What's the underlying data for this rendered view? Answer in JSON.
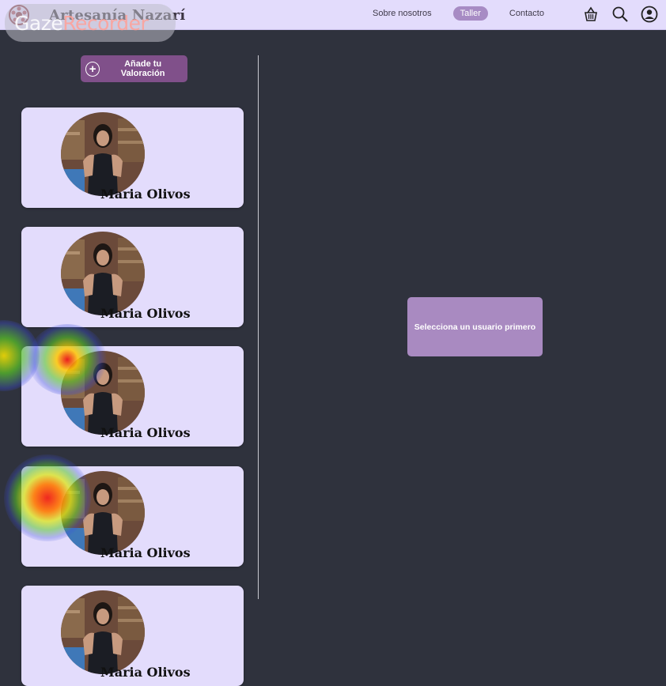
{
  "brand": {
    "name": "Artesanía Nazarí",
    "logo_icon": "pottery-logo-icon"
  },
  "nav": {
    "items": [
      {
        "label": "Sobre nosotros",
        "active": false
      },
      {
        "label": "Taller",
        "active": true
      },
      {
        "label": "Contacto",
        "active": false
      }
    ]
  },
  "header_icons": [
    "basket-icon",
    "search-icon",
    "user-account-icon"
  ],
  "watermark": {
    "part1": "Gaze",
    "part2": "Recorder"
  },
  "reviews": {
    "add_label": "Añade tu Valoración",
    "users": [
      {
        "name": "Maria Olivos"
      },
      {
        "name": "Maria Olivos"
      },
      {
        "name": "Maria Olivos"
      },
      {
        "name": "Maria Olivos"
      },
      {
        "name": "Maria Olivos"
      }
    ]
  },
  "detail": {
    "empty_message": "Selecciona un usuario primero"
  },
  "colors": {
    "topbar": "#e3dcfc",
    "background": "#2f323d",
    "card": "#e3dcfc",
    "accent_button": "#80508a",
    "active_tab": "#a78bc4",
    "message_box": "#a98ac1"
  }
}
